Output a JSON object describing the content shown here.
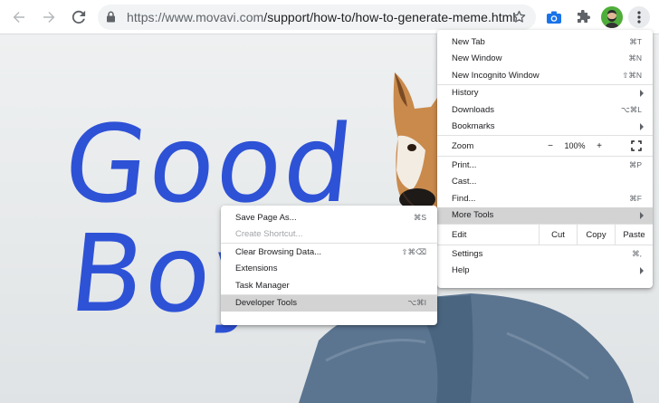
{
  "toolbar": {
    "url_host": "https://www.movavi.com",
    "url_path": "/support/how-to/how-to-generate-meme.html",
    "icons": [
      "back-arrow-icon",
      "forward-arrow-icon",
      "reload-icon",
      "lock-icon",
      "star-icon",
      "camera-icon",
      "puzzle-icon",
      "avatar",
      "kebab-menu-icon"
    ]
  },
  "page": {
    "meme_line1": "Good",
    "meme_line2": "Boy",
    "meme_color": "#2e52d6"
  },
  "main_menu": {
    "new_tab": {
      "label": "New Tab",
      "shortcut": "⌘T"
    },
    "new_window": {
      "label": "New Window",
      "shortcut": "⌘N"
    },
    "new_incognito": {
      "label": "New Incognito Window",
      "shortcut": "⇧⌘N"
    },
    "history": {
      "label": "History"
    },
    "downloads": {
      "label": "Downloads",
      "shortcut": "⌥⌘L"
    },
    "bookmarks": {
      "label": "Bookmarks"
    },
    "zoom": {
      "label": "Zoom",
      "minus": "−",
      "value": "100%",
      "plus": "+"
    },
    "print": {
      "label": "Print...",
      "shortcut": "⌘P"
    },
    "cast": {
      "label": "Cast..."
    },
    "find": {
      "label": "Find...",
      "shortcut": "⌘F"
    },
    "more_tools": {
      "label": "More Tools"
    },
    "edit": {
      "label": "Edit",
      "cut": "Cut",
      "copy": "Copy",
      "paste": "Paste"
    },
    "settings": {
      "label": "Settings",
      "shortcut": "⌘,"
    },
    "help": {
      "label": "Help"
    }
  },
  "sub_menu": {
    "save_page": {
      "label": "Save Page As...",
      "shortcut": "⌘S"
    },
    "create_shortcut": {
      "label": "Create Shortcut..."
    },
    "clear_data": {
      "label": "Clear Browsing Data...",
      "shortcut": "⇧⌘⌫"
    },
    "extensions": {
      "label": "Extensions"
    },
    "task_manager": {
      "label": "Task Manager"
    },
    "developer_tools": {
      "label": "Developer Tools",
      "shortcut": "⌥⌘I"
    }
  }
}
